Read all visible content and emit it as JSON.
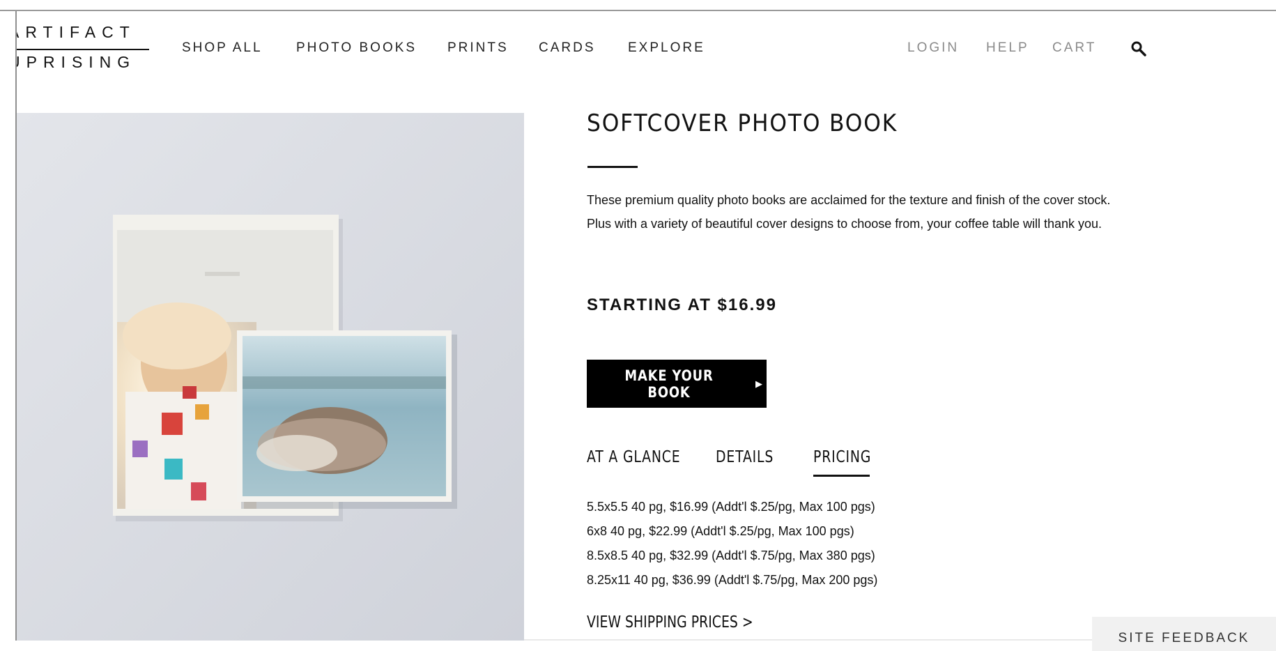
{
  "logo": {
    "line1": "ARTIFACT",
    "line2": "UPRISING"
  },
  "nav": {
    "items": [
      {
        "label": "SHOP ALL"
      },
      {
        "label": "PHOTO BOOKS"
      },
      {
        "label": "PRINTS"
      },
      {
        "label": "CARDS"
      },
      {
        "label": "EXPLORE"
      }
    ]
  },
  "utility": {
    "login": "LOGIN",
    "help": "HELP",
    "cart": "CART",
    "search_icon": "search-icon"
  },
  "product": {
    "title": "SOFTCOVER PHOTO BOOK",
    "description": "These premium quality photo books are acclaimed for the texture and finish of the cover stock. Plus with a variety of beautiful cover designs to choose from, your coffee table will thank you.",
    "starting_at": "STARTING AT $16.99",
    "cta_label": "MAKE YOUR BOOK"
  },
  "tabs": {
    "items": [
      {
        "label": "AT A GLANCE"
      },
      {
        "label": "DETAILS"
      },
      {
        "label": "PRICING"
      }
    ],
    "active": "PRICING"
  },
  "pricing": {
    "lines": [
      "5.5x5.5 40 pg, $16.99 (Addt'l $.25/pg, Max 100 pgs)",
      "6x8 40 pg, $22.99 (Addt'l $.25/pg, Max 100 pgs)",
      "8.5x8.5 40 pg, $32.99 (Addt'l $.75/pg, Max 380 pgs)",
      "8.25x11 40 pg, $36.99 (Addt'l $.75/pg, Max 200 pgs)"
    ]
  },
  "shipping_link": "VIEW SHIPPING PRICES >",
  "feedback": "SITE FEEDBACK",
  "colors": {
    "text": "#111111",
    "muted": "#8a8a8a",
    "button": "#000000",
    "hero_bg": "#dadde4"
  }
}
